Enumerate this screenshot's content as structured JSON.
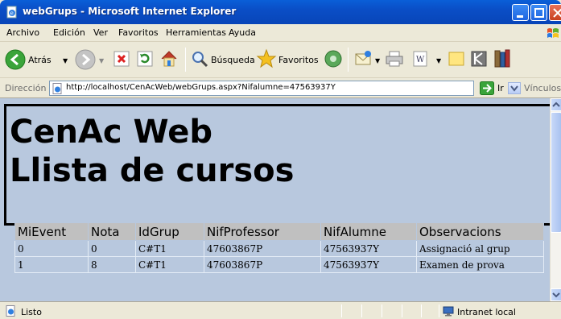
{
  "window": {
    "title": "webGrups - Microsoft Internet Explorer"
  },
  "menu": [
    "Archivo",
    "Edición",
    "Ver",
    "Favoritos",
    "Herramientas",
    "Ayuda"
  ],
  "toolbar": {
    "back_label": "Atrás",
    "search_label": "Búsqueda",
    "favorites_label": "Favoritos"
  },
  "address": {
    "label": "Dirección",
    "url": "http://localhost/CenAcWeb/webGrups.aspx?Nifalumne=47563937Y",
    "go_label": "Ir",
    "links_label": "Vínculos"
  },
  "page": {
    "title_line1": "CenAc Web",
    "title_line2": "Llista de cursos"
  },
  "table": {
    "headers": [
      "MiEvent",
      "Nota",
      "IdGrup",
      "NifProfessor",
      "NifAlumne",
      "Observacions"
    ],
    "rows": [
      [
        "0",
        "0",
        "C#T1",
        "47603867P",
        "47563937Y",
        "Assignació al grup"
      ],
      [
        "1",
        "8",
        "C#T1",
        "47603867P",
        "47563937Y",
        "Examen de prova"
      ]
    ]
  },
  "status": {
    "text": "Listo",
    "zone": "Intranet local"
  },
  "colors": {
    "titlebar": "#0a4ec6",
    "page_background": "#b8c8de",
    "header_row": "#c0c0c0"
  }
}
